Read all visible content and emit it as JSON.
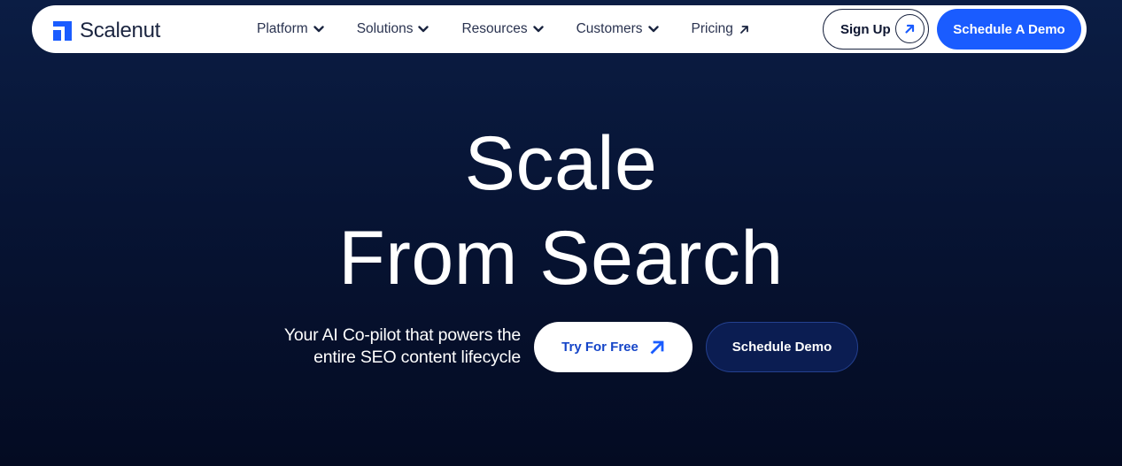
{
  "brand": {
    "name": "Scalenut",
    "color": "#1a5cff"
  },
  "nav": {
    "items": [
      {
        "label": "Platform",
        "icon": "chevron-down-icon"
      },
      {
        "label": "Solutions",
        "icon": "chevron-down-icon"
      },
      {
        "label": "Resources",
        "icon": "chevron-down-icon"
      },
      {
        "label": "Customers",
        "icon": "chevron-down-icon"
      },
      {
        "label": "Pricing",
        "icon": "arrow-up-right-icon"
      }
    ],
    "signup_label": "Sign Up",
    "demo_label": "Schedule A Demo"
  },
  "hero": {
    "line1": "Scale",
    "line2": "From Search",
    "tagline_line1": "Your AI Co-pilot that powers the",
    "tagline_line2": "entire SEO content lifecycle",
    "try_label": "Try For Free",
    "schedule_label": "Schedule Demo"
  },
  "colors": {
    "accent": "#1a5cff",
    "background": "#071434",
    "text_dark": "#1b2540"
  }
}
